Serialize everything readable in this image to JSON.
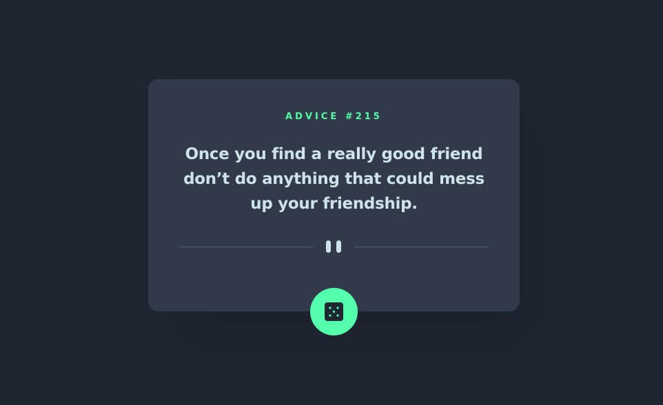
{
  "advice": {
    "label": "ADVICE #215",
    "quote": "Once you find a really good friend don’t do anything that could mess up your friendship."
  },
  "icons": {
    "divider": "pause-icon",
    "button": "dice-icon"
  },
  "colors": {
    "background": "#1f2632",
    "card": "#313a48",
    "accent": "#53ffaa",
    "text": "#cee3e9",
    "divider": "#4f5d74"
  }
}
